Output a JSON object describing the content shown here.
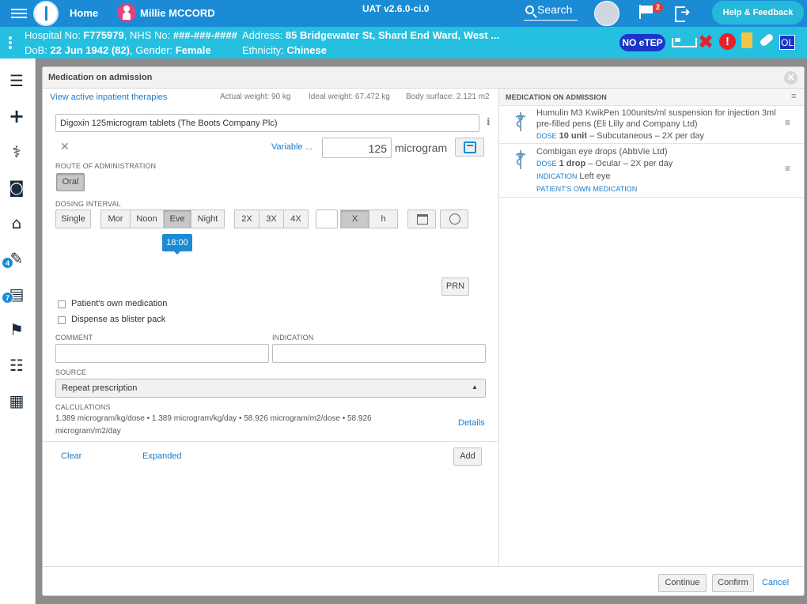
{
  "topbar": {
    "home": "Home",
    "patient_name": "Millie MCCORD",
    "version": "UAT v2.6.0-ci.0",
    "search": "Search",
    "flag_count": "2",
    "help": "Help & Feedback"
  },
  "banner": {
    "hospital_label": "Hospital No: ",
    "hospital_no": "F775979",
    "nhs_label": ", NHS No: ",
    "nhs_no": "###-###-####",
    "dob_label": "DoB: ",
    "dob": "22 Jun 1942 (82)",
    "gender_label": ", Gender: ",
    "gender": "Female",
    "address_label": "Address: ",
    "address": "85 Bridgewater St, Shard End Ward, West ...",
    "ethnicity_label": "Ethnicity: ",
    "ethnicity": "Chinese",
    "no_etep": "NO eTEP",
    "ol": "OL"
  },
  "sidebar": {
    "badge_1": "4",
    "badge_2": "7"
  },
  "modal": {
    "title": "Medication on admission",
    "view_active": "View active inpatient therapies",
    "actual_weight": "Actual weight: 90 kg",
    "ideal_weight": "Ideal weight: 67.472 kg",
    "body_surface": "Body surface: 2.121 m2",
    "drug_name": "Digoxin 125microgram tablets (The Boots Company Plc)",
    "variable": "Variable ...",
    "dose_value": "125",
    "dose_unit": "microgram",
    "route_label": "ROUTE OF ADMINISTRATION",
    "route": "Oral",
    "dosing_label": "DOSING INTERVAL",
    "single": "Single",
    "times": [
      "Mor",
      "Noon",
      "Eve",
      "Night"
    ],
    "multipliers": [
      "2X",
      "3X",
      "4X"
    ],
    "x_btn": "X",
    "h_btn": "h",
    "tooltip_time": "18:00",
    "prn": "PRN",
    "patients_own": "Patient's own medication",
    "blister": "Dispense as blister pack",
    "comment_label": "COMMENT",
    "indication_label": "INDICATION",
    "source_label": "SOURCE",
    "source_value": "Repeat prescription",
    "calc_label": "CALCULATIONS",
    "calc_line1": "1.389 microgram/kg/dose • 1.389 microgram/kg/day • 58.926 microgram/m2/dose • 58.926",
    "calc_line2": "microgram/m2/day",
    "details": "Details",
    "clear": "Clear",
    "expanded": "Expanded",
    "add": "Add"
  },
  "right": {
    "header": "MEDICATION ON ADMISSION",
    "meds": [
      {
        "name_line1": "Humulin M3 KwikPen 100units/ml suspension for injection 3ml",
        "name_line2": "pre-filled pens (Eli Lilly and Company Ltd)",
        "dose_label": "DOSE",
        "dose_value": "10 unit",
        "dose_rest": " – Subcutaneous – 2X per day"
      },
      {
        "name_line1": "Combigan eye drops (AbbVie Ltd)",
        "dose_label": "DOSE",
        "dose_value": "1 drop",
        "dose_rest": " – Ocular – 2X per day",
        "indication_label": "INDICATION",
        "indication_value": "Left eye",
        "own_med": "PATIENT'S OWN MEDICATION"
      }
    ]
  },
  "footer": {
    "continue": "Continue",
    "confirm": "Confirm",
    "cancel": "Cancel"
  }
}
